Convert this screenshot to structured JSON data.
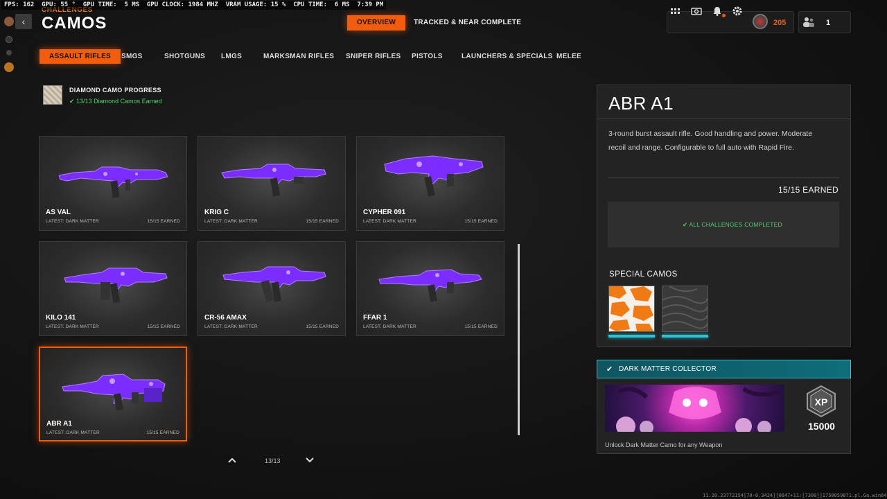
{
  "overlay": {
    "stats": "FPS: 162  GPU: 55 °  GPU TIME:  5 MS  GPU CLOCK: 1984 MHZ  VRAM USAGE: 15 %  CPU TIME:  6 MS  7:39 PM"
  },
  "header": {
    "breadcrumb": "CHALLENGES",
    "title": "CAMOS",
    "back_icon": "chevron-left-icon",
    "tabs": [
      {
        "label": "OVERVIEW",
        "active": true
      },
      {
        "label": "TRACKED & NEAR COMPLETE",
        "active": false
      }
    ],
    "rank": "205",
    "party_count": "1"
  },
  "categories": [
    {
      "label": "ASSAULT RIFLES",
      "active": true
    },
    {
      "label": "SMGS",
      "active": false
    },
    {
      "label": "SHOTGUNS",
      "active": false
    },
    {
      "label": "LMGS",
      "active": false
    },
    {
      "label": "MARKSMAN RIFLES",
      "active": false
    },
    {
      "label": "SNIPER RIFLES",
      "active": false
    },
    {
      "label": "PISTOLS",
      "active": false
    },
    {
      "label": "LAUNCHERS & SPECIALS",
      "active": false
    },
    {
      "label": "MELEE",
      "active": false
    }
  ],
  "diamond": {
    "title": "DIAMOND CAMO PROGRESS",
    "status": "13/13 Diamond Camos Earned"
  },
  "weapons": [
    {
      "name": "AS VAL",
      "latest": "LATEST: DARK MATTER",
      "earned": "15/15 EARNED"
    },
    {
      "name": "KRIG C",
      "latest": "LATEST: DARK MATTER",
      "earned": "15/15 EARNED"
    },
    {
      "name": "CYPHER 091",
      "latest": "LATEST: DARK MATTER",
      "earned": "15/15 EARNED"
    },
    {
      "name": "KILO 141",
      "latest": "LATEST: DARK MATTER",
      "earned": "15/15 EARNED"
    },
    {
      "name": "CR-56 AMAX",
      "latest": "LATEST: DARK MATTER",
      "earned": "15/15 EARNED"
    },
    {
      "name": "FFAR 1",
      "latest": "LATEST: DARK MATTER",
      "earned": "15/15 EARNED"
    },
    {
      "name": "ABR A1",
      "latest": "LATEST: DARK MATTER",
      "earned": "15/15 EARNED"
    }
  ],
  "pagination": {
    "label": "13/13"
  },
  "detail": {
    "title": "ABR A1",
    "description": "3-round burst assault rifle.  Good handling and power. Moderate recoil and range. Configurable to full auto with Rapid Fire.",
    "earned": "15/15 EARNED",
    "challenges_status": "ALL CHALLENGES COMPLETED",
    "special_title": "SPECIAL CAMOS"
  },
  "reward": {
    "title": "DARK MATTER COLLECTOR",
    "xp": "15000",
    "xp_badge": "XP",
    "description": "Unlock Dark Matter Camo for any Weapon"
  },
  "build_info": "11.20.23772154[70-0.3424][0647+11:[7300]]1758059871.pl.Ga.win64D",
  "colors": {
    "accent": "#f25c0d",
    "success": "#4bd36b",
    "teal": "#29c5d6",
    "camo_purple": "#7b2cff"
  }
}
